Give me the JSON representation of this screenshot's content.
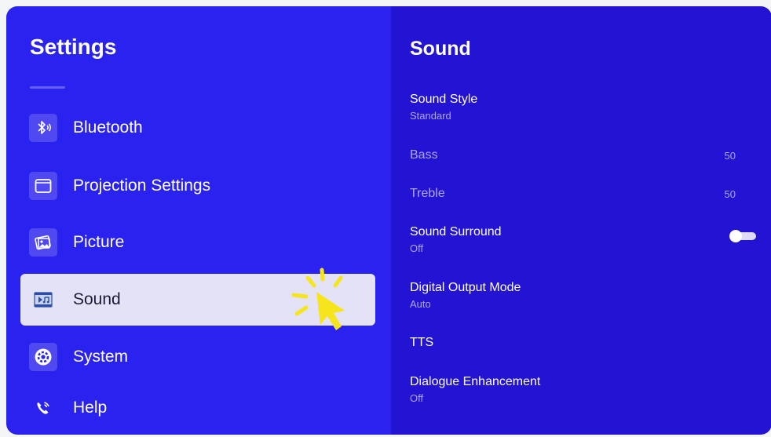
{
  "sidebar": {
    "title": "Settings",
    "items": [
      {
        "label": "Bluetooth",
        "icon": "bluetooth-icon"
      },
      {
        "label": "Projection Settings",
        "icon": "projection-icon"
      },
      {
        "label": "Picture",
        "icon": "picture-icon"
      },
      {
        "label": "Sound",
        "icon": "sound-icon",
        "selected": true
      },
      {
        "label": "System",
        "icon": "system-icon"
      },
      {
        "label": "Help",
        "icon": "help-icon"
      }
    ]
  },
  "panel": {
    "title": "Sound",
    "settings": [
      {
        "label": "Sound Style",
        "sub": "Standard"
      },
      {
        "label": "Bass",
        "value": "50"
      },
      {
        "label": "Treble",
        "value": "50"
      },
      {
        "label": "Sound Surround",
        "sub": "Off",
        "toggle": false
      },
      {
        "label": "Digital Output Mode",
        "sub": "Auto"
      },
      {
        "label": "TTS"
      },
      {
        "label": "Dialogue Enhancement",
        "sub": "Off"
      }
    ]
  },
  "colors": {
    "left_bg": "#2a22ef",
    "right_bg": "#2313d2",
    "selected_bg": "#e4e2f7",
    "cursor": "#f6e41c"
  }
}
